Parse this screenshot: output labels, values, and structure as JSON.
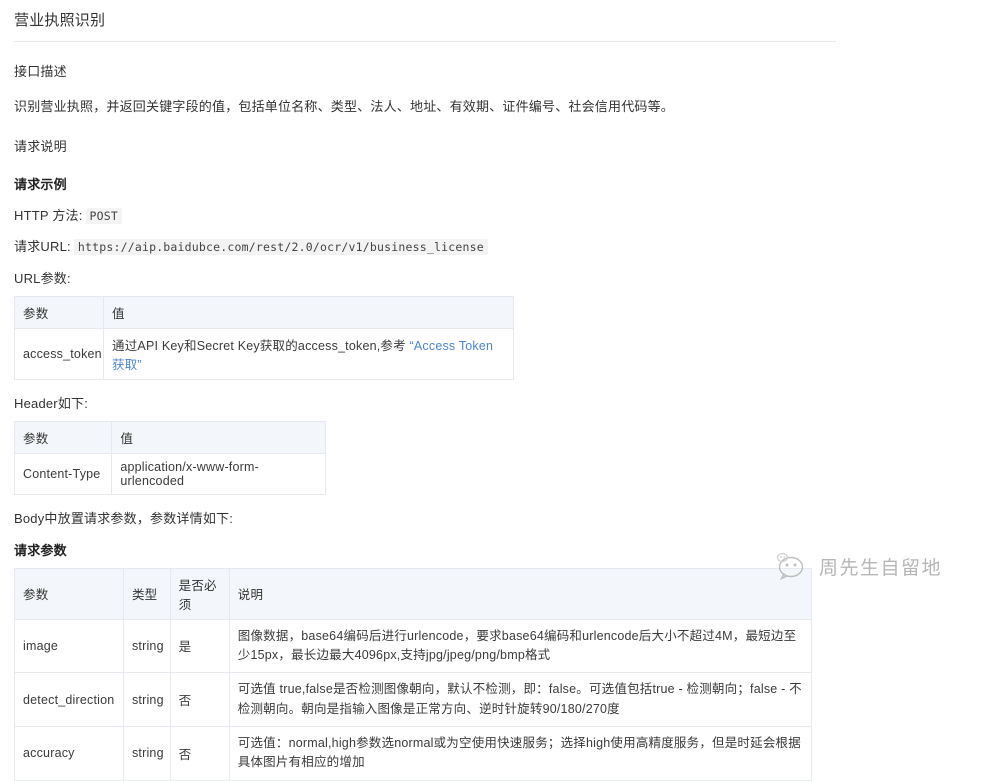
{
  "doc": {
    "title": "营业执照识别",
    "interface_desc_heading": "接口描述",
    "interface_desc_body": "识别营业执照，并返回关键字段的值，包括单位名称、类型、法人、地址、有效期、证件编号、社会信用代码等。",
    "request_desc_heading": "请求说明",
    "request_example_heading": "请求示例",
    "http_method_label": "HTTP 方法:",
    "http_method_value": "POST",
    "request_url_label": "请求URL:",
    "request_url_value": "https://aip.baidubce.com/rest/2.0/ocr/v1/business_license",
    "url_params_label": "URL参数:",
    "header_label": "Header如下:",
    "body_label": "Body中放置请求参数，参数详情如下:",
    "request_params_heading": "请求参数"
  },
  "url_params_table": {
    "headers": [
      "参数",
      "值"
    ],
    "rows": [
      {
        "param": "access_token",
        "value_prefix": "通过API Key和Secret Key获取的access_token,参考",
        "value_link": "“Access Token获取”"
      }
    ]
  },
  "header_table": {
    "headers": [
      "参数",
      "值"
    ],
    "rows": [
      {
        "param": "Content-Type",
        "value": "application/x-www-form-urlencoded"
      }
    ]
  },
  "params_table": {
    "headers": [
      "参数",
      "类型",
      "是否必须",
      "说明"
    ],
    "rows": [
      {
        "param": "image",
        "type": "string",
        "required": "是",
        "desc": "图像数据，base64编码后进行urlencode，要求base64编码和urlencode后大小不超过4M，最短边至少15px，最长边最大4096px,支持jpg/jpeg/png/bmp格式"
      },
      {
        "param": "detect_direction",
        "type": "string",
        "required": "否",
        "desc": "可选值 true,false是否检测图像朝向，默认不检测，即：false。可选值包括true - 检测朝向；false - 不检测朝向。朝向是指输入图像是正常方向、逆时针旋转90/180/270度"
      },
      {
        "param": "accuracy",
        "type": "string",
        "required": "否",
        "desc": "可选值：normal,high参数选normal或为空使用快速服务；选择high使用高精度服务，但是时延会根据具体图片有相应的增加"
      }
    ]
  },
  "watermark": {
    "text": "周先生自留地",
    "logo_name": "smiley-face-logo"
  },
  "colors": {
    "link": "#4f86d4",
    "table_header_bg": "#f3f6fa",
    "table_border": "#e6eaf0",
    "text": "#333333"
  }
}
